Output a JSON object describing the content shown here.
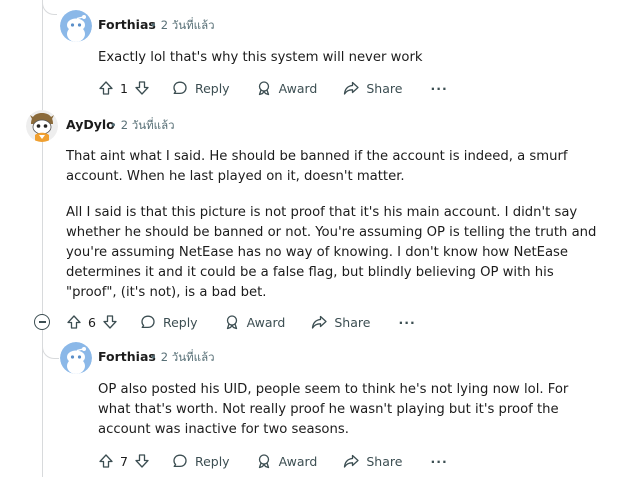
{
  "comments": [
    {
      "author": "Forthias",
      "time": "2 วันที่แล้ว",
      "body": [
        "Exactly lol that's why this system will never work"
      ],
      "votes": "1",
      "reply_label": "Reply",
      "award_label": "Award",
      "share_label": "Share",
      "more_label": "···"
    },
    {
      "author": "AyDylo",
      "time": "2 วันที่แล้ว",
      "body": [
        "That aint what I said. He should be banned if the account is indeed, a smurf account. When he last played on it, doesn't matter.",
        "All I said is that this picture is not proof that it's his main account. I didn't say whether he should be banned or not. You're assuming OP is telling the truth and you're assuming NetEase has no way of knowing. I don't know how NetEase determines it and it could be a false flag, but blindly believing OP with his \"proof\", (it's not), is a bad bet."
      ],
      "votes": "6",
      "reply_label": "Reply",
      "award_label": "Award",
      "share_label": "Share",
      "more_label": "···"
    },
    {
      "author": "Forthias",
      "time": "2 วันที่แล้ว",
      "body": [
        "OP also posted his UID, people seem to think he's not lying now lol. For what that's worth. Not really proof he wasn't playing but it's proof the account was inactive for two seasons."
      ],
      "votes": "7",
      "reply_label": "Reply",
      "award_label": "Award",
      "share_label": "Share",
      "more_label": "···"
    }
  ],
  "colors": {
    "meta": "#576f76",
    "thread": "#d8dadc",
    "avatar_blue": "#8bb8e8"
  },
  "icons": [
    "snoo-avatar",
    "custom-avatar",
    "upvote-icon",
    "downvote-icon",
    "reply-icon",
    "award-icon",
    "share-icon",
    "collapse-icon"
  ]
}
